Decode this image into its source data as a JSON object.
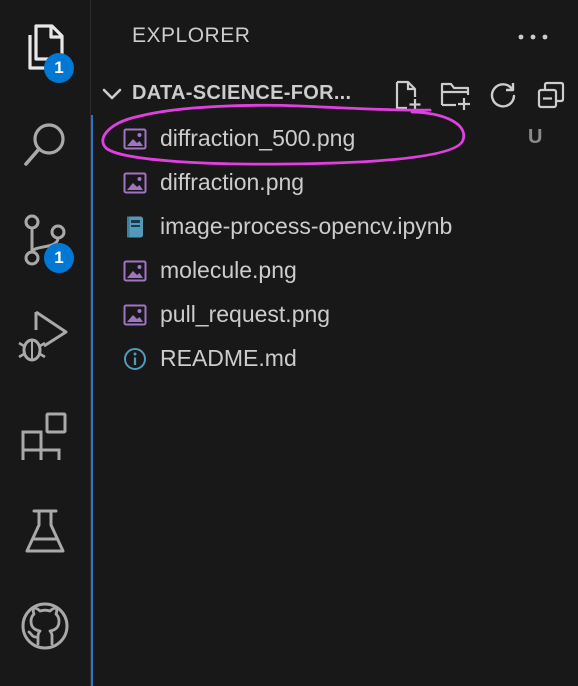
{
  "activity_bar": {
    "explorer_badge": "1",
    "source_control_badge": "1"
  },
  "explorer": {
    "title": "EXPLORER",
    "folder_name": "DATA-SCIENCE-FOR...",
    "files": [
      {
        "name": "diffraction_500.png",
        "type": "image-icon",
        "status": "U"
      },
      {
        "name": "diffraction.png",
        "type": "image-icon"
      },
      {
        "name": "image-process-opencv.ipynb",
        "type": "notebook-icon"
      },
      {
        "name": "molecule.png",
        "type": "image-icon"
      },
      {
        "name": "pull_request.png",
        "type": "image-icon"
      },
      {
        "name": "README.md",
        "type": "info-icon"
      }
    ]
  },
  "colors": {
    "background": "#181818",
    "text": "#cccccc",
    "icon": "#a9a9a9",
    "badge": "#0078d4",
    "image_icon": "#a074c4",
    "notebook_icon": "#519aba",
    "info_icon": "#519aba",
    "focus_border": "#2f73c9",
    "annotation": "#e040e0"
  }
}
